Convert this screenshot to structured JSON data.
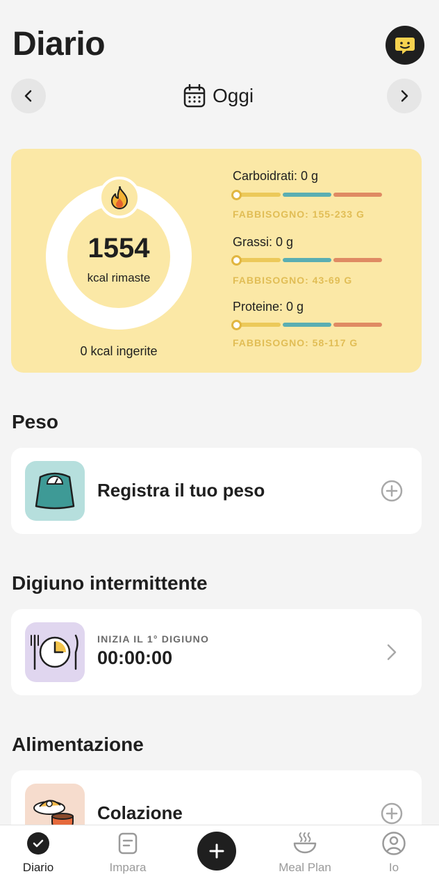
{
  "header": {
    "title": "Diario",
    "date_label": "Oggi"
  },
  "summary": {
    "kcal_remaining": "1554",
    "kcal_remaining_label": "kcal rimaste",
    "kcal_eaten": "0 kcal ingerite",
    "macros": [
      {
        "name": "Carboidrati: 0 g",
        "need": "FABBISOGNO: 155-233 G"
      },
      {
        "name": "Grassi: 0 g",
        "need": "FABBISOGNO: 43-69 G"
      },
      {
        "name": "Proteine: 0 g",
        "need": "FABBISOGNO: 58-117 G"
      }
    ]
  },
  "weight": {
    "section_title": "Peso",
    "card_label": "Registra il tuo peso"
  },
  "fasting": {
    "section_title": "Digiuno intermittente",
    "caption": "INIZIA IL 1° DIGIUNO",
    "timer": "00:00:00"
  },
  "food": {
    "section_title": "Alimentazione",
    "meal_label": "Colazione"
  },
  "bottom_nav": {
    "tabs": [
      {
        "label": "Diario",
        "icon": "check-circle-icon"
      },
      {
        "label": "Impara",
        "icon": "document-icon"
      },
      {
        "label": "Meal Plan",
        "icon": "bowl-icon"
      },
      {
        "label": "Io",
        "icon": "profile-icon"
      }
    ],
    "add_icon": "plus-icon"
  },
  "colors": {
    "summary_bg": "#fbe8a6",
    "carb": "#ecc95a",
    "fat": "#5aaeb2",
    "protein": "#df8a63",
    "need_text": "#e1bd55"
  }
}
